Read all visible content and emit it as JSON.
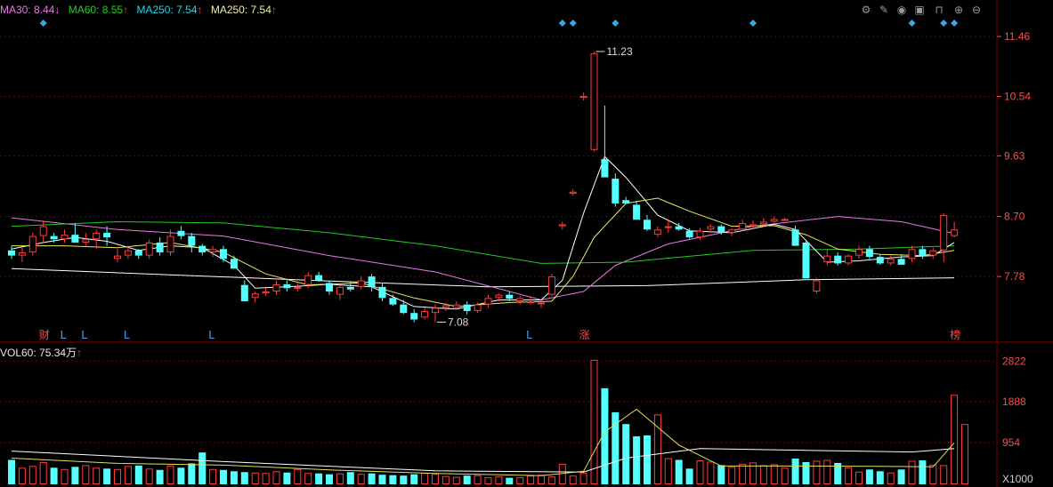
{
  "legend": {
    "ma30": {
      "label": "MA30: 8.44",
      "arrow": "↓",
      "color": "#e878e8"
    },
    "ma60": {
      "label": "MA60: 8.55",
      "arrow": "↑",
      "color": "#22cc22"
    },
    "ma250a": {
      "label": "MA250: 7.54",
      "arrow": "↑",
      "color": "#22d6e8"
    },
    "ma250b": {
      "label": "MA250: 7.54",
      "arrow": "↑",
      "color": "#f0f0a0"
    }
  },
  "volume_legend": {
    "label": "VOL60: 75.34万",
    "arrow": "↑",
    "arrow_color": "#ff4040"
  },
  "toolbar": [
    "settings-icon",
    "pen-icon",
    "eye-icon",
    "basket-icon",
    "lock-icon",
    "zoom-in-icon",
    "zoom-out-icon"
  ],
  "colors": {
    "up": "#ff3c3c",
    "down": "#54ffff",
    "grid": "#6a0000",
    "axis_text": "#ff4a4a",
    "ma_white": "#ffffff"
  },
  "chart_data": [
    {
      "type": "candlestick",
      "y_ticks": [
        "11.46",
        "10.54",
        "9.63",
        "8.70",
        "7.78"
      ],
      "y_tick_values": [
        11.46,
        10.54,
        9.63,
        8.7,
        7.78
      ],
      "ylim": [
        6.95,
        11.72
      ],
      "annotations": [
        {
          "text": "11.23",
          "index": 55,
          "value": 11.23
        },
        {
          "text": "7.08",
          "index": 40,
          "value": 7.08
        }
      ],
      "event_markers": [
        {
          "text": "财",
          "index": 3
        },
        {
          "text": "L",
          "index": 5
        },
        {
          "text": "L",
          "index": 7
        },
        {
          "text": "L",
          "index": 11
        },
        {
          "text": "L",
          "index": 19
        },
        {
          "text": "L",
          "index": 49
        },
        {
          "text": "涨",
          "index": 54
        },
        {
          "text": "榜",
          "index": 89
        }
      ],
      "diamond_markers": [
        3,
        52,
        53,
        57,
        70,
        85,
        88,
        89
      ],
      "candles": [
        [
          8.18,
          8.25,
          8.05,
          8.1
        ],
        [
          8.1,
          8.22,
          8.0,
          8.15
        ],
        [
          8.15,
          8.45,
          8.1,
          8.4
        ],
        [
          8.4,
          8.62,
          8.3,
          8.55
        ],
        [
          8.4,
          8.45,
          8.3,
          8.35
        ],
        [
          8.35,
          8.5,
          8.3,
          8.42
        ],
        [
          8.42,
          8.6,
          8.38,
          8.3
        ],
        [
          8.3,
          8.45,
          8.25,
          8.35
        ],
        [
          8.35,
          8.5,
          8.2,
          8.45
        ],
        [
          8.45,
          8.55,
          8.25,
          8.38
        ],
        [
          8.05,
          8.2,
          8.0,
          8.1
        ],
        [
          8.1,
          8.25,
          8.05,
          8.18
        ],
        [
          8.18,
          8.2,
          8.05,
          8.1
        ],
        [
          8.1,
          8.35,
          8.05,
          8.3
        ],
        [
          8.3,
          8.38,
          8.1,
          8.15
        ],
        [
          8.15,
          8.5,
          8.1,
          8.4
        ],
        [
          8.48,
          8.55,
          8.35,
          8.4
        ],
        [
          8.4,
          8.45,
          8.15,
          8.25
        ],
        [
          8.25,
          8.28,
          8.1,
          8.15
        ],
        [
          8.15,
          8.25,
          8.08,
          8.2
        ],
        [
          8.2,
          8.25,
          8.0,
          8.05
        ],
        [
          8.05,
          8.1,
          7.92,
          7.9
        ],
        [
          7.65,
          7.72,
          7.4,
          7.4
        ],
        [
          7.45,
          7.55,
          7.38,
          7.52
        ],
        [
          7.52,
          7.6,
          7.48,
          7.55
        ],
        [
          7.55,
          7.72,
          7.5,
          7.66
        ],
        [
          7.66,
          7.72,
          7.55,
          7.6
        ],
        [
          7.6,
          7.68,
          7.55,
          7.62
        ],
        [
          7.65,
          7.85,
          7.6,
          7.8
        ],
        [
          7.8,
          7.85,
          7.7,
          7.72
        ],
        [
          7.68,
          7.72,
          7.5,
          7.55
        ],
        [
          7.5,
          7.65,
          7.42,
          7.62
        ],
        [
          7.62,
          7.7,
          7.55,
          7.58
        ],
        [
          7.62,
          7.78,
          7.58,
          7.72
        ],
        [
          7.78,
          7.82,
          7.55,
          7.62
        ],
        [
          7.62,
          7.68,
          7.4,
          7.45
        ],
        [
          7.45,
          7.5,
          7.33,
          7.35
        ],
        [
          7.35,
          7.42,
          7.2,
          7.22
        ],
        [
          7.22,
          7.28,
          7.08,
          7.12
        ],
        [
          7.15,
          7.3,
          7.12,
          7.25
        ],
        [
          7.22,
          7.35,
          7.08,
          7.3
        ],
        [
          7.3,
          7.38,
          7.25,
          7.34
        ],
        [
          7.3,
          7.4,
          7.28,
          7.35
        ],
        [
          7.35,
          7.4,
          7.2,
          7.25
        ],
        [
          7.25,
          7.38,
          7.22,
          7.35
        ],
        [
          7.35,
          7.5,
          7.3,
          7.45
        ],
        [
          7.45,
          7.52,
          7.4,
          7.5
        ],
        [
          7.5,
          7.55,
          7.4,
          7.44
        ],
        [
          7.4,
          7.48,
          7.35,
          7.45
        ],
        [
          7.4,
          7.48,
          7.35,
          7.4
        ],
        [
          7.36,
          7.42,
          7.3,
          7.38
        ],
        [
          7.5,
          7.82,
          7.48,
          7.78
        ],
        [
          8.55,
          8.62,
          8.5,
          8.58
        ],
        [
          9.05,
          9.12,
          9.02,
          9.08
        ],
        [
          10.52,
          10.6,
          10.48,
          10.55
        ],
        [
          9.72,
          11.23,
          9.7,
          11.2
        ],
        [
          9.58,
          10.4,
          9.3,
          9.3
        ],
        [
          9.28,
          9.36,
          8.85,
          8.9
        ],
        [
          8.95,
          9.0,
          8.9,
          8.9
        ],
        [
          8.88,
          8.94,
          8.65,
          8.65
        ],
        [
          8.65,
          8.72,
          8.48,
          8.5
        ],
        [
          8.42,
          8.55,
          8.38,
          8.5
        ],
        [
          8.54,
          8.64,
          8.45,
          8.55
        ],
        [
          8.55,
          8.6,
          8.48,
          8.5
        ],
        [
          8.48,
          8.52,
          8.36,
          8.38
        ],
        [
          8.38,
          8.52,
          8.34,
          8.48
        ],
        [
          8.5,
          8.58,
          8.45,
          8.55
        ],
        [
          8.55,
          8.58,
          8.42,
          8.45
        ],
        [
          8.45,
          8.52,
          8.4,
          8.5
        ],
        [
          8.5,
          8.65,
          8.48,
          8.6
        ],
        [
          8.55,
          8.64,
          8.5,
          8.58
        ],
        [
          8.58,
          8.68,
          8.55,
          8.62
        ],
        [
          8.62,
          8.7,
          8.58,
          8.66
        ],
        [
          8.66,
          8.68,
          8.64,
          8.66
        ],
        [
          8.5,
          8.56,
          8.25,
          8.25
        ],
        [
          8.3,
          8.32,
          7.75,
          7.75
        ],
        [
          7.55,
          7.76,
          7.52,
          7.72
        ],
        [
          8.0,
          8.2,
          7.95,
          8.1
        ],
        [
          8.1,
          8.15,
          7.95,
          7.98
        ],
        [
          7.98,
          8.12,
          7.95,
          8.1
        ],
        [
          8.1,
          8.25,
          8.05,
          8.2
        ],
        [
          8.2,
          8.25,
          8.05,
          8.08
        ],
        [
          8.08,
          8.12,
          7.96,
          7.98
        ],
        [
          7.98,
          8.1,
          7.95,
          8.05
        ],
        [
          8.05,
          8.12,
          7.98,
          7.96
        ],
        [
          8.05,
          8.25,
          8.0,
          8.2
        ],
        [
          8.2,
          8.25,
          8.05,
          8.1
        ],
        [
          8.1,
          8.22,
          8.05,
          8.18
        ],
        [
          8.18,
          8.75,
          8.0,
          8.72
        ],
        [
          8.4,
          8.62,
          8.38,
          8.5
        ]
      ],
      "lines": [
        {
          "name": "MA250",
          "color": "#ffffff",
          "points": [
            [
              0,
              7.9
            ],
            [
              30,
              7.71
            ],
            [
              45,
              7.62
            ],
            [
              60,
              7.64
            ],
            [
              75,
              7.73
            ],
            [
              89,
              7.76
            ]
          ]
        },
        {
          "name": "MA30",
          "color": "#e878e8",
          "points": [
            [
              0,
              8.68
            ],
            [
              10,
              8.5
            ],
            [
              20,
              8.4
            ],
            [
              30,
              8.1
            ],
            [
              40,
              7.85
            ],
            [
              50,
              7.42
            ],
            [
              54,
              7.55
            ],
            [
              57,
              7.95
            ],
            [
              62,
              8.28
            ],
            [
              70,
              8.55
            ],
            [
              78,
              8.7
            ],
            [
              84,
              8.62
            ],
            [
              89,
              8.44
            ]
          ]
        },
        {
          "name": "MA60",
          "color": "#22cc22",
          "points": [
            [
              0,
              8.55
            ],
            [
              10,
              8.62
            ],
            [
              20,
              8.6
            ],
            [
              30,
              8.45
            ],
            [
              40,
              8.25
            ],
            [
              50,
              7.98
            ],
            [
              58,
              8.0
            ],
            [
              70,
              8.18
            ],
            [
              80,
              8.2
            ],
            [
              89,
              8.25
            ]
          ]
        },
        {
          "name": "MA5",
          "color": "#ffffff",
          "points": [
            [
              0,
              8.2
            ],
            [
              3,
              8.3
            ],
            [
              6,
              8.38
            ],
            [
              9,
              8.32
            ],
            [
              12,
              8.18
            ],
            [
              15,
              8.25
            ],
            [
              18,
              8.22
            ],
            [
              21,
              7.95
            ],
            [
              23,
              7.6
            ],
            [
              27,
              7.63
            ],
            [
              30,
              7.66
            ],
            [
              34,
              7.62
            ],
            [
              38,
              7.32
            ],
            [
              42,
              7.28
            ],
            [
              46,
              7.42
            ],
            [
              50,
              7.42
            ],
            [
              52,
              7.72
            ],
            [
              54,
              8.75
            ],
            [
              56,
              9.62
            ],
            [
              58,
              9.3
            ],
            [
              61,
              8.72
            ],
            [
              64,
              8.48
            ],
            [
              68,
              8.45
            ],
            [
              72,
              8.58
            ],
            [
              74,
              8.5
            ],
            [
              77,
              8.0
            ],
            [
              80,
              8.02
            ],
            [
              84,
              8.08
            ],
            [
              87,
              8.1
            ],
            [
              89,
              8.3
            ]
          ]
        },
        {
          "name": "MA10",
          "color": "#eaea60",
          "points": [
            [
              0,
              8.25
            ],
            [
              5,
              8.25
            ],
            [
              10,
              8.22
            ],
            [
              15,
              8.3
            ],
            [
              20,
              8.15
            ],
            [
              24,
              7.82
            ],
            [
              28,
              7.65
            ],
            [
              33,
              7.68
            ],
            [
              38,
              7.45
            ],
            [
              42,
              7.32
            ],
            [
              47,
              7.38
            ],
            [
              51,
              7.4
            ],
            [
              53,
              7.78
            ],
            [
              55,
              8.38
            ],
            [
              58,
              8.9
            ],
            [
              61,
              8.98
            ],
            [
              64,
              8.78
            ],
            [
              68,
              8.55
            ],
            [
              72,
              8.56
            ],
            [
              75,
              8.42
            ],
            [
              78,
              8.2
            ],
            [
              82,
              8.12
            ],
            [
              86,
              8.1
            ],
            [
              89,
              8.18
            ]
          ]
        }
      ]
    },
    {
      "type": "bar",
      "title": "VOL60",
      "y_ticks": [
        "2822",
        "1888",
        "954",
        "X1000"
      ],
      "y_tick_values": [
        2822,
        1888,
        954,
        0
      ],
      "ylim": [
        0,
        2950
      ],
      "values": [
        560,
        380,
        420,
        510,
        380,
        350,
        400,
        440,
        380,
        360,
        350,
        420,
        430,
        360,
        330,
        430,
        380,
        480,
        730,
        350,
        330,
        300,
        280,
        270,
        260,
        300,
        270,
        350,
        260,
        250,
        230,
        250,
        280,
        240,
        250,
        220,
        210,
        200,
        230,
        260,
        240,
        190,
        170,
        200,
        210,
        160,
        180,
        150,
        160,
        200,
        220,
        180,
        470,
        200,
        260,
        2850,
        2200,
        1650,
        1380,
        1100,
        1120,
        1600,
        600,
        560,
        360,
        550,
        520,
        440,
        400,
        470,
        500,
        440,
        460,
        380,
        590,
        510,
        540,
        560,
        490,
        390,
        290,
        340,
        300,
        270,
        340,
        540,
        550,
        450,
        440,
        2050,
        1380
      ],
      "ma_line": {
        "color": "#e0e060",
        "points": [
          [
            0,
            600
          ],
          [
            10,
            480
          ],
          [
            20,
            440
          ],
          [
            30,
            330
          ],
          [
            40,
            250
          ],
          [
            50,
            200
          ],
          [
            54,
            300
          ],
          [
            56,
            1200
          ],
          [
            59,
            1720
          ],
          [
            63,
            900
          ],
          [
            67,
            420
          ],
          [
            75,
            420
          ],
          [
            82,
            410
          ],
          [
            87,
            400
          ],
          [
            89,
            950
          ]
        ]
      },
      "ma_line_white": {
        "color": "#ffffff",
        "points": [
          [
            0,
            760
          ],
          [
            20,
            520
          ],
          [
            40,
            310
          ],
          [
            54,
            280
          ],
          [
            58,
            600
          ],
          [
            65,
            820
          ],
          [
            75,
            780
          ],
          [
            85,
            740
          ],
          [
            89,
            820
          ]
        ]
      }
    }
  ]
}
